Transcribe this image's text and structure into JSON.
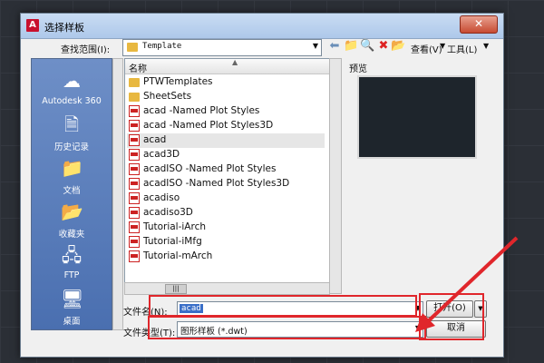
{
  "window": {
    "title": "选择样板",
    "close_glyph": "✕"
  },
  "lookin": {
    "label": "查找范围(I):",
    "value": "Template"
  },
  "toolbar": {
    "view_label": "查看(V)",
    "tools_label": "工具(L)",
    "icons": [
      "back-arrow-icon",
      "up-folder-icon",
      "search-web-icon",
      "delete-icon",
      "new-folder-icon"
    ]
  },
  "places": [
    {
      "name": "autodesk-360",
      "label": "Autodesk 360",
      "icon": "cloud-icon"
    },
    {
      "name": "history",
      "label": "历史记录",
      "icon": "history-icon"
    },
    {
      "name": "documents",
      "label": "文档",
      "icon": "documents-icon"
    },
    {
      "name": "favorites",
      "label": "收藏夹",
      "icon": "favorites-icon"
    },
    {
      "name": "ftp",
      "label": "FTP",
      "icon": "ftp-icon"
    },
    {
      "name": "desktop",
      "label": "桌面",
      "icon": "desktop-icon"
    }
  ],
  "filelist": {
    "header": "名称",
    "items": [
      {
        "name": "PTWTemplates",
        "type": "folder"
      },
      {
        "name": "SheetSets",
        "type": "folder"
      },
      {
        "name": "acad -Named Plot Styles",
        "type": "dwt"
      },
      {
        "name": "acad -Named Plot Styles3D",
        "type": "dwt"
      },
      {
        "name": "acad",
        "type": "dwt",
        "selected": true
      },
      {
        "name": "acad3D",
        "type": "dwt"
      },
      {
        "name": "acadISO -Named Plot Styles",
        "type": "dwt"
      },
      {
        "name": "acadISO -Named Plot Styles3D",
        "type": "dwt"
      },
      {
        "name": "acadiso",
        "type": "dwt"
      },
      {
        "name": "acadiso3D",
        "type": "dwt"
      },
      {
        "name": "Tutorial-iArch",
        "type": "dwt"
      },
      {
        "name": "Tutorial-iMfg",
        "type": "dwt"
      },
      {
        "name": "Tutorial-mArch",
        "type": "dwt"
      }
    ]
  },
  "preview": {
    "label": "预览"
  },
  "filename": {
    "label": "文件名(N):",
    "value": "acad"
  },
  "filetype": {
    "label": "文件类型(T):",
    "value": "图形样板 (*.dwt)"
  },
  "buttons": {
    "open": "打开(O)",
    "cancel": "取消"
  },
  "colors": {
    "highlight": "#e0262b",
    "selection": "#3a6fc8"
  }
}
